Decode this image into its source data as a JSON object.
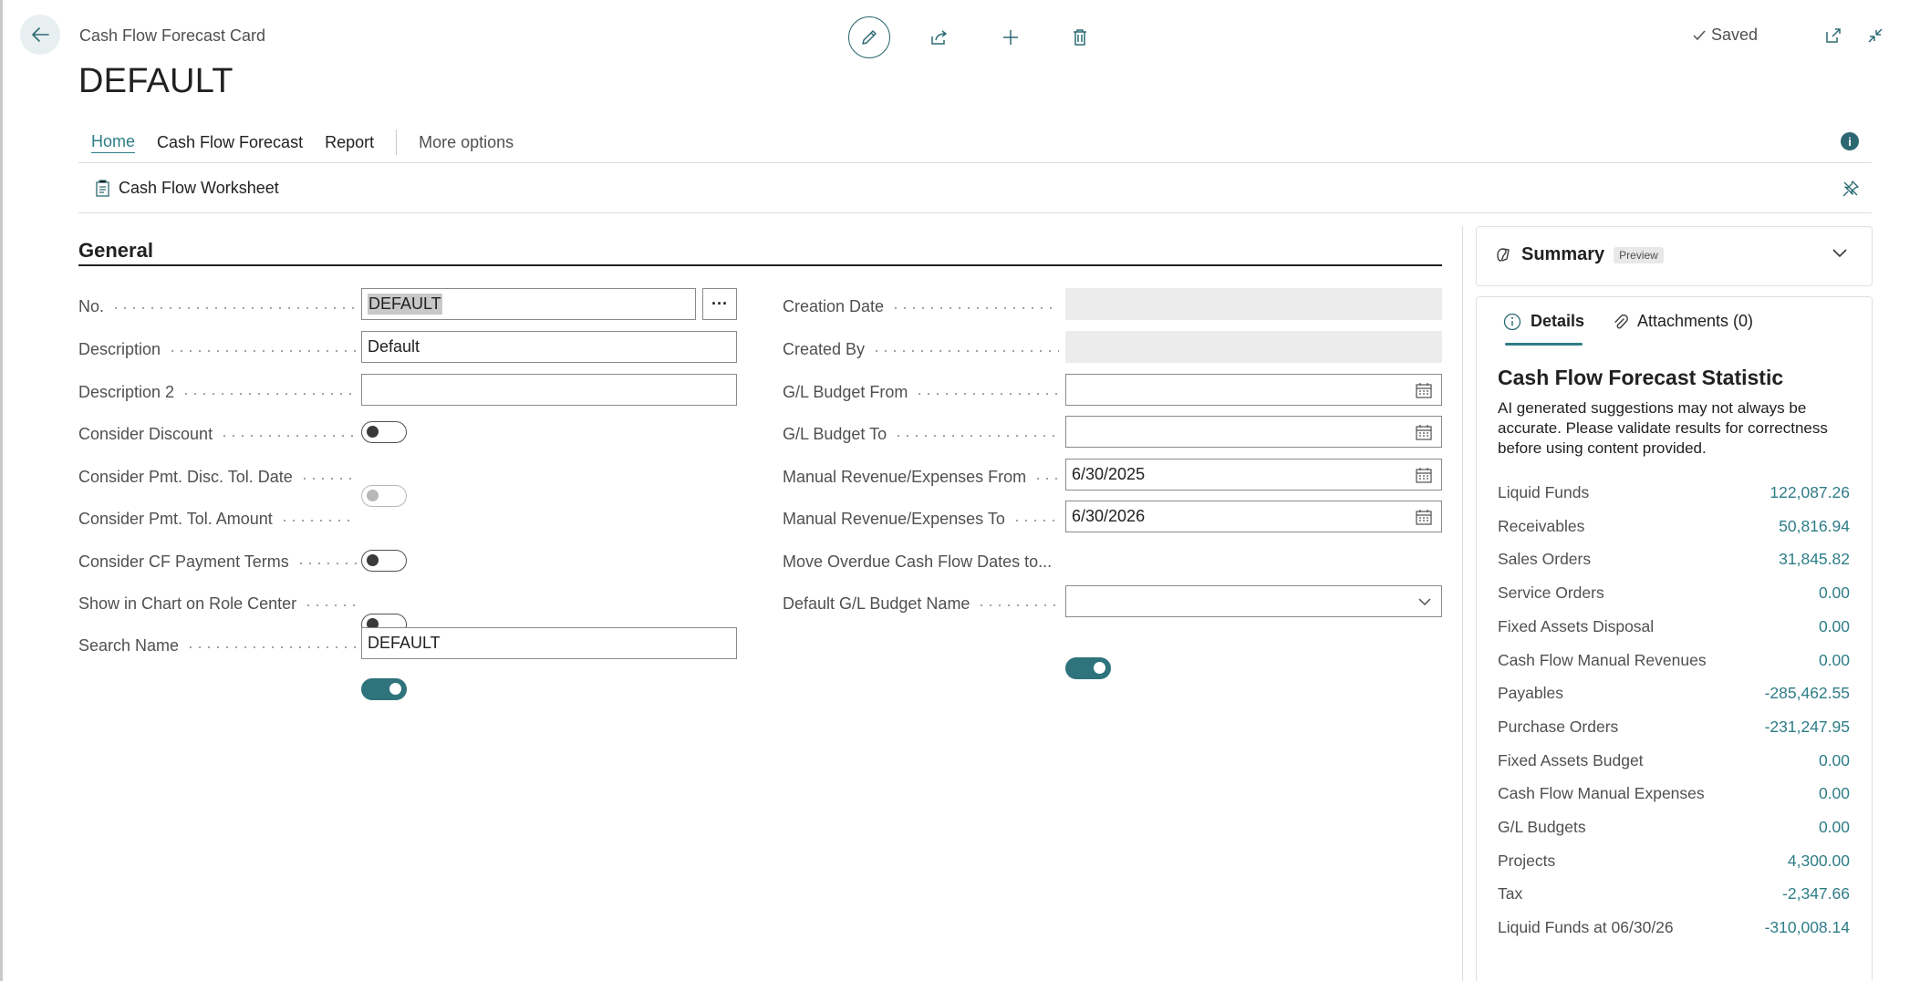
{
  "header": {
    "breadcrumb": "Cash Flow Forecast Card",
    "title": "DEFAULT",
    "saved_label": "Saved"
  },
  "actions": {
    "tabs": [
      "Home",
      "Cash Flow Forecast",
      "Report"
    ],
    "more_options": "More options",
    "worksheet": "Cash Flow Worksheet"
  },
  "general": {
    "title": "General",
    "left": {
      "no": {
        "label": "No.",
        "value": "DEFAULT"
      },
      "description": {
        "label": "Description",
        "value": "Default"
      },
      "description2": {
        "label": "Description 2",
        "value": ""
      },
      "consider_discount": {
        "label": "Consider Discount",
        "on": false
      },
      "consider_pmt_disc_tol_date": {
        "label": "Consider Pmt. Disc. Tol. Date",
        "on": false,
        "disabled": true
      },
      "consider_pmt_tol_amount": {
        "label": "Consider Pmt. Tol. Amount",
        "on": false
      },
      "consider_cf_payment_terms": {
        "label": "Consider CF Payment Terms",
        "on": false
      },
      "show_in_chart": {
        "label": "Show in Chart on Role Center",
        "on": true
      },
      "search_name": {
        "label": "Search Name",
        "value": "DEFAULT"
      }
    },
    "right": {
      "creation_date": {
        "label": "Creation Date",
        "value": ""
      },
      "created_by": {
        "label": "Created By",
        "value": ""
      },
      "gl_budget_from": {
        "label": "G/L Budget From",
        "value": ""
      },
      "gl_budget_to": {
        "label": "G/L Budget To",
        "value": ""
      },
      "manual_from": {
        "label": "Manual Revenue/Expenses From",
        "value": "6/30/2025"
      },
      "manual_to": {
        "label": "Manual Revenue/Expenses To",
        "value": "6/30/2026"
      },
      "move_overdue": {
        "label": "Move Overdue Cash Flow Dates to...",
        "on": true
      },
      "default_gl_budget_name": {
        "label": "Default G/L Budget Name",
        "value": ""
      }
    }
  },
  "factbox": {
    "summary_title": "Summary",
    "preview_badge": "Preview",
    "tab_details": "Details",
    "tab_attachments": "Attachments (0)",
    "stat_title": "Cash Flow Forecast Statistic",
    "disclaimer": "AI generated suggestions may not always be accurate. Please validate results for correctness before using content provided.",
    "stats": [
      {
        "label": "Liquid Funds",
        "value": "122,087.26"
      },
      {
        "label": "Receivables",
        "value": "50,816.94"
      },
      {
        "label": "Sales Orders",
        "value": "31,845.82"
      },
      {
        "label": "Service Orders",
        "value": "0.00"
      },
      {
        "label": "Fixed Assets Disposal",
        "value": "0.00"
      },
      {
        "label": "Cash Flow Manual Revenues",
        "value": "0.00"
      },
      {
        "label": "Payables",
        "value": "-285,462.55"
      },
      {
        "label": "Purchase Orders",
        "value": "-231,247.95"
      },
      {
        "label": "Fixed Assets Budget",
        "value": "0.00"
      },
      {
        "label": "Cash Flow Manual Expenses",
        "value": "0.00"
      },
      {
        "label": "G/L Budgets",
        "value": "0.00"
      },
      {
        "label": "Projects",
        "value": "4,300.00"
      },
      {
        "label": "Tax",
        "value": "-2,347.66"
      },
      {
        "label": "Liquid Funds at 06/30/26",
        "value": "-310,008.14"
      }
    ]
  },
  "colors": {
    "accent": "#2e7d87",
    "toggle_on": "#2f737c"
  }
}
